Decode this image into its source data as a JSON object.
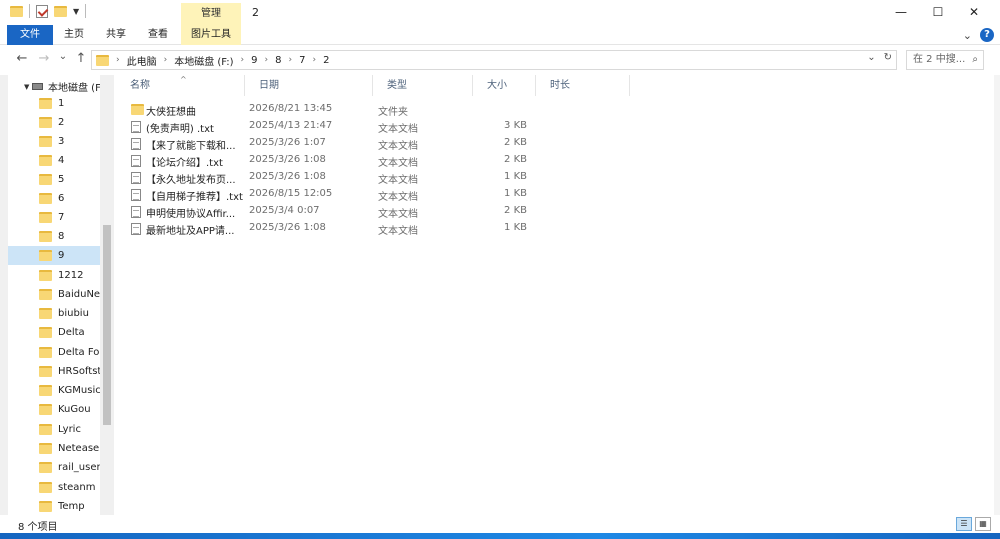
{
  "window": {
    "title": "2",
    "context_tab_header": "管理",
    "controls": {
      "minimize": "—",
      "maximize": "☐",
      "close": "✕"
    }
  },
  "ribbon": {
    "tabs": [
      "文件",
      "主页",
      "共享",
      "查看",
      "图片工具"
    ],
    "collapse": "⌄",
    "help": "?"
  },
  "nav": {
    "back": "←",
    "forward": "→",
    "recent": "⌄",
    "up": "↑",
    "breadcrumb": [
      "此电脑",
      "本地磁盘 (F:)",
      "9",
      "8",
      "7",
      "2"
    ],
    "dropdown": "⌄",
    "refresh": "↻",
    "search_placeholder": "在 2 中搜...",
    "search_icon": "⌕"
  },
  "sidebar": {
    "drive": "本地磁盘 (F:)",
    "items": [
      "1",
      "2",
      "3",
      "4",
      "5",
      "6",
      "7",
      "8",
      "9",
      "1212",
      "BaiduNet",
      "biubiu",
      "Delta",
      "Delta Force",
      "HRSoftstore",
      "KGMusic",
      "KuGou",
      "Lyric",
      "Netease",
      "rail_user_data",
      "steanm",
      "Temp"
    ],
    "selected": "9"
  },
  "columns": {
    "name": "名称",
    "date": "日期",
    "type": "类型",
    "size": "大小",
    "duration": "时长"
  },
  "files": [
    {
      "name": "大侠狂想曲",
      "date": "2026/8/21 13:45",
      "type": "文件夹",
      "size": "",
      "icon": "folder"
    },
    {
      "name": "(免责声明) .txt",
      "date": "2025/4/13 21:47",
      "type": "文本文档",
      "size": "3 KB",
      "icon": "txt"
    },
    {
      "name": "【来了就能下载和...",
      "date": "2025/3/26 1:07",
      "type": "文本文档",
      "size": "2 KB",
      "icon": "txt"
    },
    {
      "name": "【论坛介绍】.txt",
      "date": "2025/3/26 1:08",
      "type": "文本文档",
      "size": "2 KB",
      "icon": "txt"
    },
    {
      "name": "【永久地址发布页...",
      "date": "2025/3/26 1:08",
      "type": "文本文档",
      "size": "1 KB",
      "icon": "txt"
    },
    {
      "name": "【自用梯子推荐】.txt",
      "date": "2026/8/15 12:05",
      "type": "文本文档",
      "size": "1 KB",
      "icon": "txt"
    },
    {
      "name": "申明使用协议Affir...",
      "date": "2025/3/4 0:07",
      "type": "文本文档",
      "size": "2 KB",
      "icon": "txt"
    },
    {
      "name": "最新地址及APP请...",
      "date": "2025/3/26 1:08",
      "type": "文本文档",
      "size": "1 KB",
      "icon": "txt"
    }
  ],
  "status": {
    "count": "8 个项目"
  },
  "colors": {
    "accent": "#1a66c4",
    "context_tab": "#fef3b9",
    "selection": "#cce4f7"
  }
}
